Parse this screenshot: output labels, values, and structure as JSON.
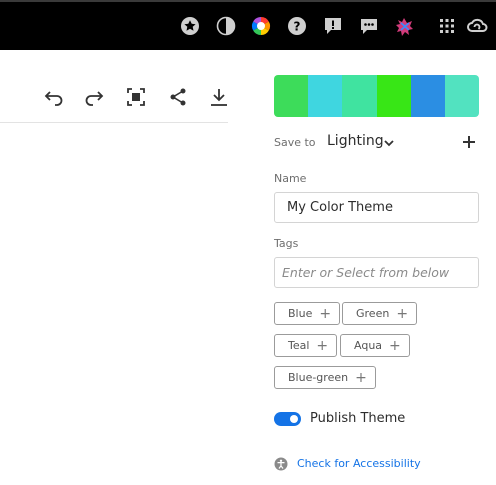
{
  "topbar": {
    "icons": [
      "star-badge-icon",
      "contrast-icon",
      "color-wheel-icon",
      "help-icon",
      "feedback-alert-icon",
      "chat-icon",
      "puzzle-extension-icon",
      "apps-grid-icon",
      "creative-cloud-icon"
    ]
  },
  "toolbar": {
    "icons": [
      "undo-icon",
      "redo-icon",
      "fit-to-screen-icon",
      "share-icon",
      "download-icon"
    ]
  },
  "theme": {
    "swatches": [
      "#3DDC5A",
      "#3FD6E0",
      "#40E3A0",
      "#38E616",
      "#2B8EE3",
      "#52E2C0"
    ]
  },
  "save_to": {
    "label": "Save to",
    "value": "Lighting"
  },
  "name_field": {
    "label": "Name",
    "value": "My Color Theme"
  },
  "tags_field": {
    "label": "Tags",
    "placeholder": "Enter or Select from below"
  },
  "tags": [
    {
      "label": "Blue"
    },
    {
      "label": "Green"
    },
    {
      "label": "Teal"
    },
    {
      "label": "Aqua"
    },
    {
      "label": "Blue-green"
    }
  ],
  "publish": {
    "label": "Publish Theme",
    "enabled": true
  },
  "accessibility": {
    "link_label": "Check for Accessibility"
  },
  "colors": {
    "accent": "#1473e6",
    "topbar": "#000000"
  }
}
